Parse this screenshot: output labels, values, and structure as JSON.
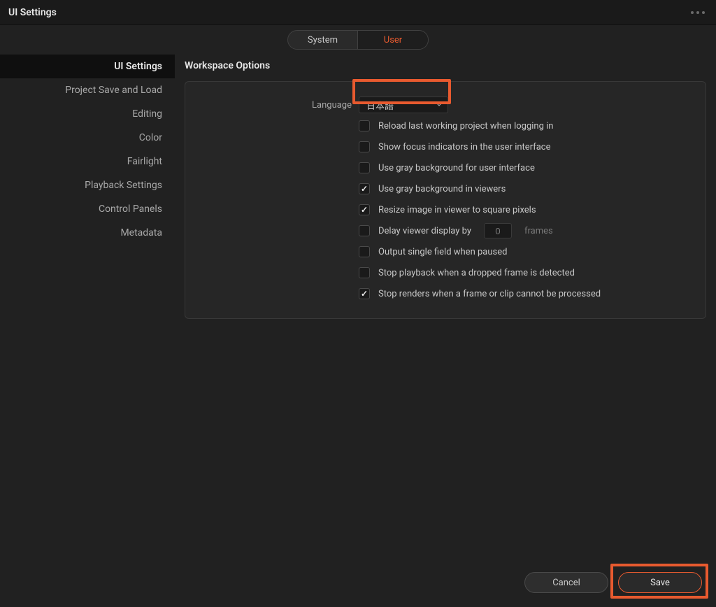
{
  "titlebar": {
    "title": "UI Settings"
  },
  "tabs": {
    "system": "System",
    "user": "User"
  },
  "sidebar": {
    "items": [
      {
        "label": "UI Settings",
        "active": true
      },
      {
        "label": "Project Save and Load",
        "active": false
      },
      {
        "label": "Editing",
        "active": false
      },
      {
        "label": "Color",
        "active": false
      },
      {
        "label": "Fairlight",
        "active": false
      },
      {
        "label": "Playback Settings",
        "active": false
      },
      {
        "label": "Control Panels",
        "active": false
      },
      {
        "label": "Metadata",
        "active": false
      }
    ]
  },
  "section": {
    "title": "Workspace Options"
  },
  "language": {
    "label": "Language",
    "value": "日本語"
  },
  "options": [
    {
      "label": "Reload last working project when logging in",
      "checked": false
    },
    {
      "label": "Show focus indicators in the user interface",
      "checked": false
    },
    {
      "label": "Use gray background for user interface",
      "checked": false
    },
    {
      "label": "Use gray background in viewers",
      "checked": true
    },
    {
      "label": "Resize image in viewer to square pixels",
      "checked": true
    },
    {
      "label": "Delay viewer display by",
      "checked": false,
      "input": "0",
      "unit": "frames"
    },
    {
      "label": "Output single field when paused",
      "checked": false
    },
    {
      "label": "Stop playback when a dropped frame is detected",
      "checked": false
    },
    {
      "label": "Stop renders when a frame or clip cannot be processed",
      "checked": true
    }
  ],
  "footer": {
    "cancel": "Cancel",
    "save": "Save"
  }
}
